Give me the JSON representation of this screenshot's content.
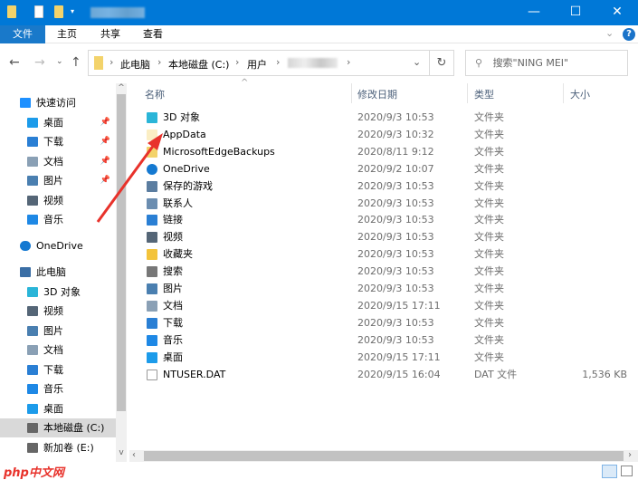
{
  "window": {
    "minimize": "—",
    "maximize": "☐",
    "close": "✕"
  },
  "ribbon": {
    "tabs": [
      "文件",
      "主页",
      "共享",
      "查看"
    ],
    "help": "?",
    "expand": "⌄"
  },
  "address": {
    "crumbs": [
      "此电脑",
      "本地磁盘 (C:)",
      "用户"
    ],
    "search_placeholder": "搜索\"NING MEI\""
  },
  "columns": {
    "name": "名称",
    "date": "修改日期",
    "type": "类型",
    "size": "大小"
  },
  "sidebar": [
    {
      "label": "快速访问",
      "icon": "star-icon",
      "color": "#1e90ff",
      "pinned": false
    },
    {
      "label": "桌面",
      "icon": "desktop-icon",
      "color": "#1c9bea",
      "pinned": true
    },
    {
      "label": "下载",
      "icon": "download-icon",
      "color": "#2a7fd4",
      "pinned": true
    },
    {
      "label": "文档",
      "icon": "document-icon",
      "color": "#8aa0b5",
      "pinned": true
    },
    {
      "label": "图片",
      "icon": "pictures-icon",
      "color": "#4a7fb0",
      "pinned": true
    },
    {
      "label": "视频",
      "icon": "video-icon",
      "color": "#556677",
      "pinned": false
    },
    {
      "label": "音乐",
      "icon": "music-icon",
      "color": "#1e88e5",
      "pinned": false
    },
    {
      "label": "OneDrive",
      "icon": "cloud-icon",
      "color": "#1479d1",
      "pinned": false
    },
    {
      "label": "此电脑",
      "icon": "computer-icon",
      "color": "#3a6ea5",
      "pinned": false
    },
    {
      "label": "3D 对象",
      "icon": "cube-icon",
      "color": "#2ab5d8",
      "pinned": false
    },
    {
      "label": "视频",
      "icon": "video-icon",
      "color": "#556677",
      "pinned": false
    },
    {
      "label": "图片",
      "icon": "pictures-icon",
      "color": "#4a7fb0",
      "pinned": false
    },
    {
      "label": "文档",
      "icon": "document-icon",
      "color": "#8aa0b5",
      "pinned": false
    },
    {
      "label": "下载",
      "icon": "download-icon",
      "color": "#2a7fd4",
      "pinned": false
    },
    {
      "label": "音乐",
      "icon": "music-icon",
      "color": "#1e88e5",
      "pinned": false
    },
    {
      "label": "桌面",
      "icon": "desktop-icon",
      "color": "#1c9bea",
      "pinned": false
    },
    {
      "label": "本地磁盘 (C:)",
      "icon": "drive-icon",
      "color": "#666",
      "pinned": false
    },
    {
      "label": "新加卷 (E:)",
      "icon": "drive-icon",
      "color": "#666",
      "pinned": false
    }
  ],
  "pin_glyph": "📌",
  "files": [
    {
      "name": "3D 对象",
      "date": "2020/9/3 10:53",
      "type": "文件夹",
      "size": "",
      "icon": "cube-icon",
      "color": "#2ab5d8"
    },
    {
      "name": "AppData",
      "date": "2020/9/3 10:32",
      "type": "文件夹",
      "size": "",
      "icon": "folder-icon",
      "color": "#fbeec4"
    },
    {
      "name": "MicrosoftEdgeBackups",
      "date": "2020/8/11 9:12",
      "type": "文件夹",
      "size": "",
      "icon": "folder-icon",
      "color": "#f3d36b"
    },
    {
      "name": "OneDrive",
      "date": "2020/9/2 10:07",
      "type": "文件夹",
      "size": "",
      "icon": "cloud-icon",
      "color": "#1479d1"
    },
    {
      "name": "保存的游戏",
      "date": "2020/9/3 10:53",
      "type": "文件夹",
      "size": "",
      "icon": "saved-games-icon",
      "color": "#5b7da0"
    },
    {
      "name": "联系人",
      "date": "2020/9/3 10:53",
      "type": "文件夹",
      "size": "",
      "icon": "contacts-icon",
      "color": "#6b8db0"
    },
    {
      "name": "链接",
      "date": "2020/9/3 10:53",
      "type": "文件夹",
      "size": "",
      "icon": "link-icon",
      "color": "#2a7fd4"
    },
    {
      "name": "视频",
      "date": "2020/9/3 10:53",
      "type": "文件夹",
      "size": "",
      "icon": "video-icon",
      "color": "#556677"
    },
    {
      "name": "收藏夹",
      "date": "2020/9/3 10:53",
      "type": "文件夹",
      "size": "",
      "icon": "favorites-icon",
      "color": "#f3c33b"
    },
    {
      "name": "搜索",
      "date": "2020/9/3 10:53",
      "type": "文件夹",
      "size": "",
      "icon": "search-icon",
      "color": "#777"
    },
    {
      "name": "图片",
      "date": "2020/9/3 10:53",
      "type": "文件夹",
      "size": "",
      "icon": "pictures-icon",
      "color": "#4a7fb0"
    },
    {
      "name": "文档",
      "date": "2020/9/15 17:11",
      "type": "文件夹",
      "size": "",
      "icon": "document-icon",
      "color": "#8aa0b5"
    },
    {
      "name": "下载",
      "date": "2020/9/3 10:53",
      "type": "文件夹",
      "size": "",
      "icon": "download-icon",
      "color": "#2a7fd4"
    },
    {
      "name": "音乐",
      "date": "2020/9/3 10:53",
      "type": "文件夹",
      "size": "",
      "icon": "music-icon",
      "color": "#1e88e5"
    },
    {
      "name": "桌面",
      "date": "2020/9/15 17:11",
      "type": "文件夹",
      "size": "",
      "icon": "desktop-icon",
      "color": "#1c9bea"
    },
    {
      "name": "NTUSER.DAT",
      "date": "2020/9/15 16:04",
      "type": "DAT 文件",
      "size": "1,536 KB",
      "icon": "file-icon",
      "color": "#ffffff"
    }
  ],
  "watermark": "php中文网",
  "colors": {
    "titlebar": "#0078d7",
    "arrow": "#e8322b"
  }
}
